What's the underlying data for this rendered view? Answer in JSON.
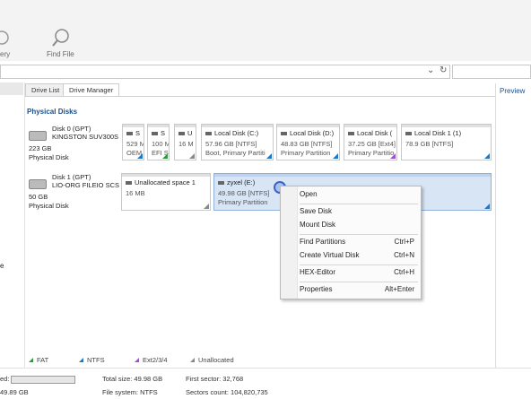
{
  "toolbar": {
    "recovery_label": "ery",
    "find_file_label": "Find File"
  },
  "tabs": [
    {
      "label": "Drive List"
    },
    {
      "label": "Drive Manager"
    }
  ],
  "preview_label": "Preview",
  "section_title": "Physical Disks",
  "disks": [
    {
      "name": "Disk 0 (GPT)",
      "model": "KINGSTON SUV300S",
      "size": "223 GB",
      "kind": "Physical Disk",
      "partitions": [
        {
          "name": "S",
          "size": "529 M",
          "type": "OEM"
        },
        {
          "name": "S",
          "size": "100 M",
          "type": "EFI S"
        },
        {
          "name": "U",
          "size": "16 M",
          "type": ""
        },
        {
          "name": "Local Disk (C:)",
          "size": "57.96 GB [NTFS]",
          "type": "Boot, Primary Partiti"
        },
        {
          "name": "Local Disk (D:)",
          "size": "48.83 GB [NTFS]",
          "type": "Primary Partition"
        },
        {
          "name": "Local Disk (",
          "size": "37.25 GB [Ext4]",
          "type": "Primary Partitio"
        },
        {
          "name": "Local Disk 1 (1)",
          "size": "78.9 GB [NTFS]",
          "type": ""
        }
      ]
    },
    {
      "name": "Disk 1 (GPT)",
      "model": "LIO-ORG FILEIO SCS",
      "size": "50 GB",
      "kind": "Physical Disk",
      "partitions": [
        {
          "name": "Unallocated space 1",
          "size": "16 MB",
          "type": ""
        },
        {
          "name": "zyxel (E:)",
          "size": "49.98 GB [NTFS]",
          "type": "Primary Partition"
        }
      ]
    }
  ],
  "context_menu": {
    "items": [
      {
        "label": "Open",
        "shortcut": ""
      },
      {
        "label": "Save Disk",
        "shortcut": ""
      },
      {
        "label": "Mount Disk",
        "shortcut": ""
      },
      {
        "label": "Find Partitions",
        "shortcut": "Ctrl+P"
      },
      {
        "label": "Create Virtual Disk",
        "shortcut": "Ctrl+N"
      },
      {
        "label": "HEX-Editor",
        "shortcut": "Ctrl+H"
      },
      {
        "label": "Properties",
        "shortcut": "Alt+Enter"
      }
    ]
  },
  "legend": [
    {
      "label": "FAT",
      "color": "#2e9b3a"
    },
    {
      "label": "NTFS",
      "color": "#1e78c8"
    },
    {
      "label": "Ext2/3/4",
      "color": "#a04fd0"
    },
    {
      "label": "Unallocated",
      "color": "#888888"
    }
  ],
  "status": {
    "used_label": "ed:",
    "free_value": "49.89 GB",
    "total_size": "Total size: 49.98 GB",
    "file_system": "File system: NTFS",
    "first_sector": "First sector: 32,768",
    "sectors_count": "Sectors count: 104,820,735"
  },
  "left_pane_fragment": "e"
}
